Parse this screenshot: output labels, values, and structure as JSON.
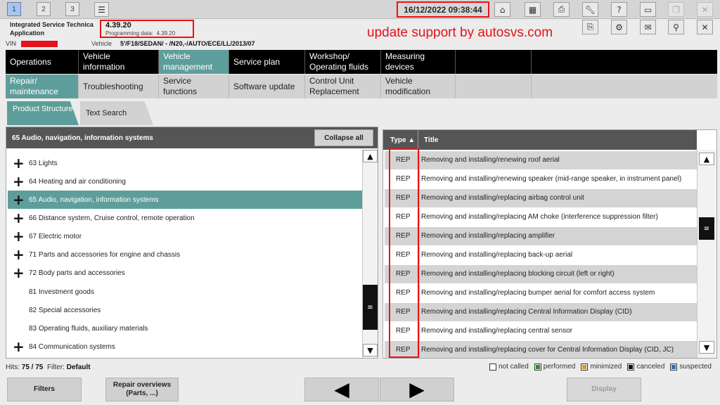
{
  "windows": [
    "1",
    "2",
    "3"
  ],
  "datetime": "16/12/2022 09:38:44",
  "app": {
    "name_line1": "Integrated Service Technica",
    "name_line2": "Application",
    "version": "4.39.20",
    "prog_label": "Programming data:",
    "prog_value": "4.39.20"
  },
  "watermark": "update support by autosvs.com",
  "vin": {
    "label": "VIN",
    "vehicle_label": "Vehicle",
    "vehicle_value": "5'/F18/SEDAN/ - /N20,-/AUTO/ECE/LL/2013/07"
  },
  "nav1": [
    {
      "label": "Operations"
    },
    {
      "label": "Vehicle information"
    },
    {
      "label": "Vehicle management"
    },
    {
      "label": "Service plan"
    },
    {
      "label": "Workshop/ Operating fluids"
    },
    {
      "label": "Measuring devices"
    }
  ],
  "nav2": [
    {
      "label": "Repair/ maintenance"
    },
    {
      "label": "Troubleshooting"
    },
    {
      "label": "Service functions"
    },
    {
      "label": "Software update"
    },
    {
      "label": "Control Unit Replacement"
    },
    {
      "label": "Vehicle modification"
    }
  ],
  "subtabs": [
    "Product Structure",
    "Text Search"
  ],
  "tree": {
    "header": "65 Audio, navigation, information systems",
    "collapse_label": "Collapse all",
    "items": [
      {
        "label": "63 Lights",
        "expandable": true
      },
      {
        "label": "64 Heating and air conditioning",
        "expandable": true
      },
      {
        "label": "65 Audio, navigation, information systems",
        "expandable": true
      },
      {
        "label": "66 Distance system, Cruise control, remote operation",
        "expandable": true
      },
      {
        "label": "67 Electric motor",
        "expandable": true
      },
      {
        "label": "71 Parts and accessories for engine and chassis",
        "expandable": true
      },
      {
        "label": "72 Body parts and accessories",
        "expandable": true
      },
      {
        "label": "81 Investment goods",
        "expandable": false
      },
      {
        "label": "82 Special accessories",
        "expandable": false
      },
      {
        "label": "83 Operating fluids, auxiliary materials",
        "expandable": false
      },
      {
        "label": "84 Communication systems",
        "expandable": true
      }
    ]
  },
  "table": {
    "col_type": "Type ▲",
    "col_title": "Title",
    "rows": [
      {
        "type": "REP",
        "title": "Removing and installing/renewing roof aerial"
      },
      {
        "type": "REP",
        "title": "Removing and installing/renewing speaker (mid-range speaker, in instrument panel)"
      },
      {
        "type": "REP",
        "title": "Removing and installing/replacing airbag control unit"
      },
      {
        "type": "REP",
        "title": "Removing and installing/replacing AM choke (interference suppression filter)"
      },
      {
        "type": "REP",
        "title": "Removing and installing/replacing amplifier"
      },
      {
        "type": "REP",
        "title": "Removing and installing/replacing back-up aerial"
      },
      {
        "type": "REP",
        "title": "Removing and installing/replacing blocking circuit (left or right)"
      },
      {
        "type": "REP",
        "title": "Removing and installing/replacing bumper aerial for comfort access system"
      },
      {
        "type": "REP",
        "title": "Removing and installing/replacing Central Information Display (CID)"
      },
      {
        "type": "REP",
        "title": "Removing and installing/replacing central sensor"
      },
      {
        "type": "REP",
        "title": "Removing and installing/replacing cover for Central Information Display (CID, JC)"
      }
    ]
  },
  "status": {
    "hits_label": "Hits:",
    "hits_value": "75 / 75",
    "filter_label": "Filter:",
    "filter_value": "Default"
  },
  "legend": [
    {
      "label": "not called",
      "color": "#ffffff"
    },
    {
      "label": "performed",
      "color": "#2e8b2e"
    },
    {
      "label": "minimized",
      "color": "#c8a02a"
    },
    {
      "label": "canceled",
      "color": "#111111"
    },
    {
      "label": "suspected",
      "color": "#3a66c4"
    }
  ],
  "buttons": {
    "filters": "Filters",
    "repair_overviews_1": "Repair overviews",
    "repair_overviews_2": "(Parts, ...)",
    "display": "Display"
  },
  "colors": {
    "accent": "#5e9e9a",
    "highlight": "#e11111"
  }
}
